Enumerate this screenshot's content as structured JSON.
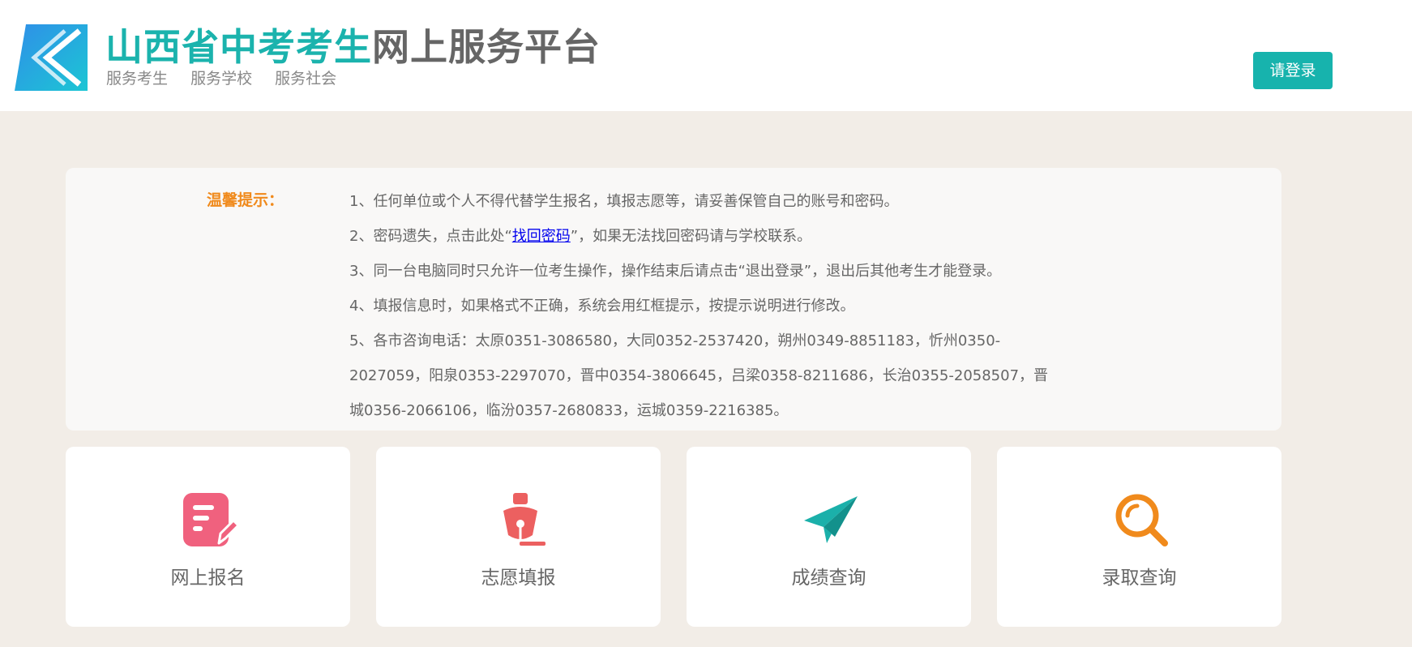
{
  "header": {
    "title_part1": "山西省中考考生",
    "title_part2": "网上服务平台",
    "slogans": [
      "服务考生",
      "服务学校",
      "服务社会"
    ],
    "login_label": "请登录"
  },
  "notice": {
    "label": "温馨提示：",
    "item1": "1、任何单位或个人不得代替学生报名，填报志愿等，请妥善保管自己的账号和密码。",
    "item2_prefix": "2、密码遗失，点击此处“",
    "item2_link": "找回密码",
    "item2_suffix": "”，如果无法找回密码请与学校联系。",
    "item3": "3、同一台电脑同时只允许一位考生操作，操作结束后请点击“退出登录”，退出后其他考生才能登录。",
    "item4": "4、填报信息时，如果格式不正确，系统会用红框提示，按提示说明进行修改。",
    "item5": "5、各市咨询电话：太原0351-3086580，大同0352-2537420，朔州0349-8851183，忻州0350-2027059，阳泉0353-2297070，晋中0354-3806645，吕梁0358-8211686，长治0355-2058507，晋城0356-2066106，临汾0357-2680833，运城0359-2216385。"
  },
  "cards": [
    {
      "label": "网上报名",
      "icon": "form-edit-icon"
    },
    {
      "label": "志愿填报",
      "icon": "fountain-pen-icon"
    },
    {
      "label": "成绩查询",
      "icon": "paper-plane-icon"
    },
    {
      "label": "录取查询",
      "icon": "magnifier-icon"
    }
  ],
  "colors": {
    "accent": "#17b3ad",
    "notice_label": "#f08a1c",
    "icon_pink": "#f0617e",
    "icon_red": "#ec6060",
    "icon_teal": "#1bb0aa",
    "icon_orange": "#f08a1c",
    "background": "#f2ede7"
  }
}
